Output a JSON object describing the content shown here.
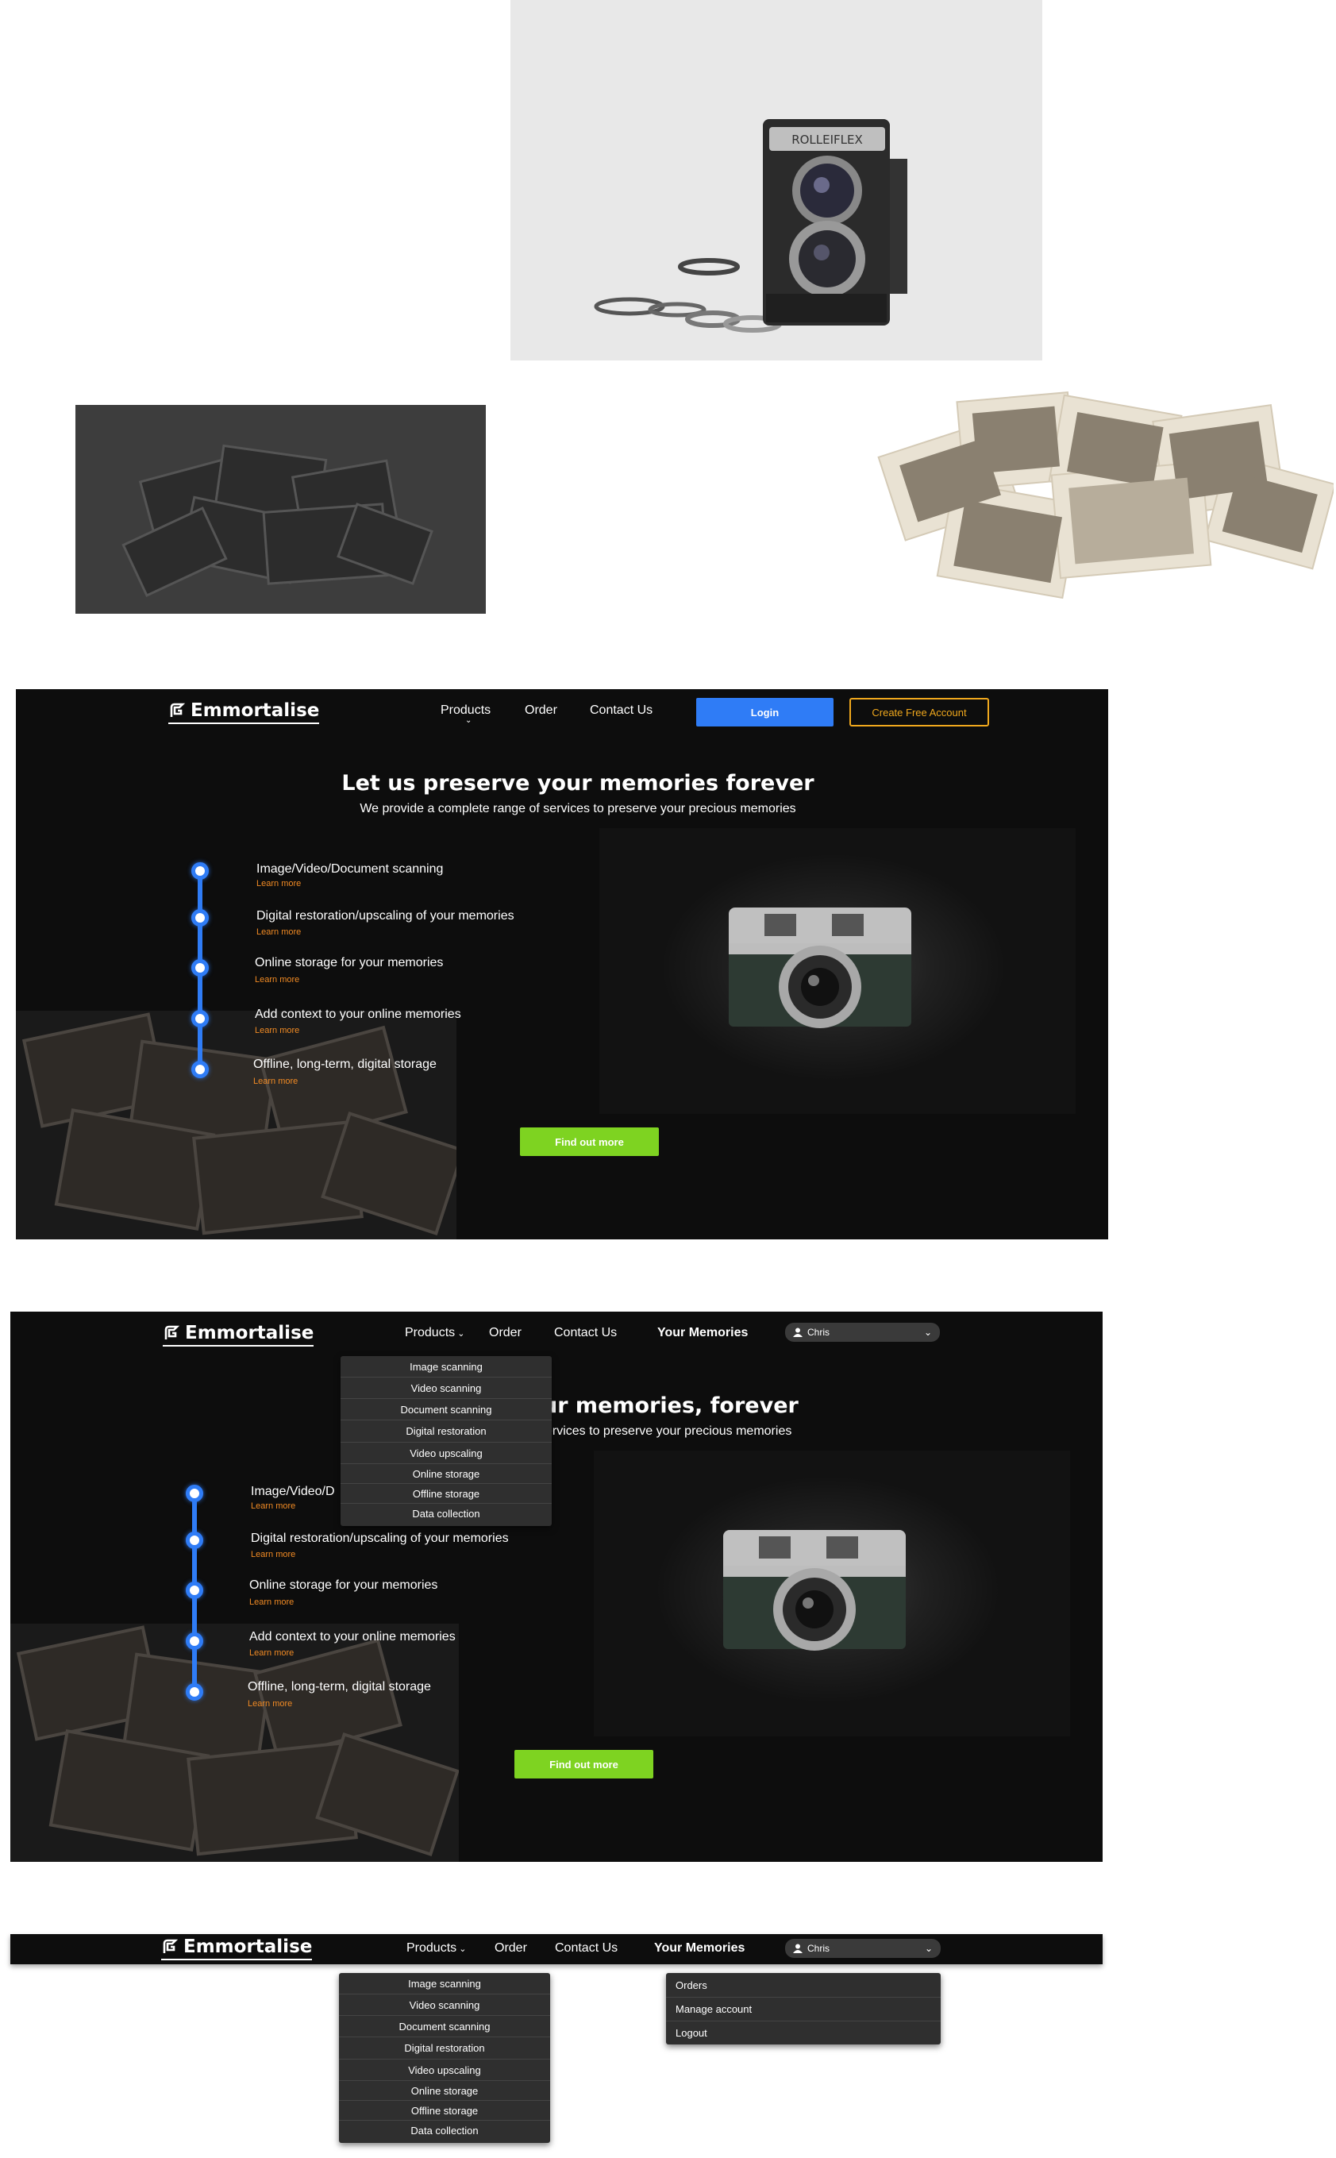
{
  "brand": {
    "name": "Emmortalise"
  },
  "nav": {
    "products": "Products",
    "order": "Order",
    "contact": "Contact Us",
    "login": "Login",
    "create_account": "Create Free Account",
    "your_memories": "Your Memories"
  },
  "user": {
    "name": "Chris"
  },
  "hero": {
    "title": "Let us preserve your memories forever",
    "subtitle": "We provide a complete range of services to preserve your precious memories",
    "title_partial": "ur memories, forever",
    "subtitle_partial": "ervices to preserve your precious memories"
  },
  "services": [
    {
      "label": "Image/Video/Document scanning",
      "link": "Learn more"
    },
    {
      "label": "Digital restoration/upscaling of your memories",
      "link": "Learn more"
    },
    {
      "label": "Online storage for your memories",
      "link": "Learn more"
    },
    {
      "label": "Add context to your online memories",
      "link": "Learn more"
    },
    {
      "label": "Offline, long-term, digital storage",
      "link": "Learn more"
    }
  ],
  "service_partial_first": "Image/Video/D",
  "cta": {
    "find_out_more": "Find out more"
  },
  "products_menu": [
    "Image scanning",
    "Video scanning",
    "Document scanning",
    "Digital restoration",
    "Video upscaling",
    "Online storage",
    "Offline storage",
    "Data collection"
  ],
  "user_menu": [
    "Orders",
    "Manage account",
    "Logout"
  ],
  "assets": {
    "camera_brand_text": "ROLLEIFLEX"
  },
  "colors": {
    "accent_blue": "#2f7cf6",
    "accent_orange": "#f0a81d",
    "cta_green": "#7ed321",
    "link_orange": "#f08a24",
    "background": "#0d0d0d"
  }
}
